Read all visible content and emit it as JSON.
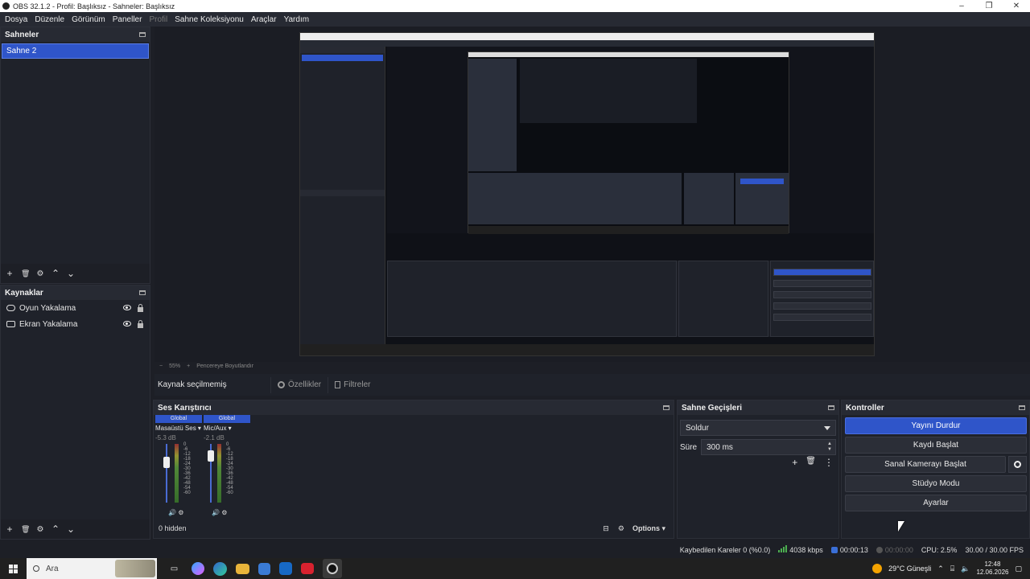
{
  "window": {
    "title": "OBS 32.1.2 - Profil: Başlıksız - Sahneler: Başlıksız",
    "controls": [
      "–",
      "❐",
      "✕"
    ]
  },
  "menu": [
    {
      "label": "Dosya",
      "enabled": true
    },
    {
      "label": "Düzenle",
      "enabled": true
    },
    {
      "label": "Görünüm",
      "enabled": true
    },
    {
      "label": "Paneller",
      "enabled": true
    },
    {
      "label": "Profil",
      "enabled": false
    },
    {
      "label": "Sahne Koleksiyonu",
      "enabled": true
    },
    {
      "label": "Araçlar",
      "enabled": true
    },
    {
      "label": "Yardım",
      "enabled": true
    }
  ],
  "scenes": {
    "title": "Sahneler",
    "items": [
      "Sahne 2"
    ],
    "toolbar": [
      "+",
      "🗑",
      "⚙",
      "⌃",
      "⌄"
    ]
  },
  "sources": {
    "title": "Kaynaklar",
    "items": [
      {
        "name": "Oyun Yakalama",
        "icon": "gamepad-icon",
        "visible": true,
        "locked": true
      },
      {
        "name": "Ekran Yakalama",
        "icon": "monitor-icon",
        "visible": true,
        "locked": true
      }
    ],
    "toolbar": [
      "+",
      "🗑",
      "⚙",
      "⌃",
      "⌄"
    ]
  },
  "zoom": {
    "minus": "−",
    "value": "55%",
    "plus": "+",
    "fit_label": "Pencereye Boyutlandır"
  },
  "properties_bar": {
    "status": "Kaynak seçilmemiş",
    "properties_label": "Özellikler",
    "filters_label": "Filtreler"
  },
  "mixer": {
    "title": "Ses Karıştırıcı",
    "channels": [
      {
        "badge": "Global",
        "name": "Masaüstü Ses",
        "db": "-5.3 dB",
        "level": 0.55
      },
      {
        "badge": "Global",
        "name": "Mic/Aux",
        "db": "-2.1 dB",
        "level": 0.75
      }
    ],
    "scale": [
      "0",
      "-6",
      "-12",
      "-18",
      "-24",
      "-30",
      "-36",
      "-42",
      "-48",
      "-54",
      "-60"
    ],
    "hidden_label": "0 hidden",
    "options_label": "Options"
  },
  "transitions": {
    "title": "Sahne Geçişleri",
    "selected": "Soldur",
    "duration_label": "Süre",
    "duration_value": "300 ms"
  },
  "controls": {
    "title": "Kontroller",
    "stop_stream": "Yayını Durdur",
    "start_record": "Kaydı Başlat",
    "virtual_cam": "Sanal Kamerayı Başlat",
    "studio_mode": "Stüdyo Modu",
    "settings": "Ayarlar"
  },
  "status": {
    "dropped": "Kaybedilen Kareler 0 (%0.0)",
    "bitrate": "4038 kbps",
    "stream_time": "00:00:13",
    "record_time": "00:00:00",
    "cpu": "CPU: 2.5%",
    "fps": "30.00 / 30.00 FPS"
  },
  "taskbar": {
    "search_placeholder": "Ara",
    "weather": "29°C Güneşli",
    "time": "12:48",
    "date": "12.06.2026"
  },
  "colors": {
    "accent": "#2f55c9",
    "panel": "#1f222a",
    "background": "#1d1f26"
  }
}
